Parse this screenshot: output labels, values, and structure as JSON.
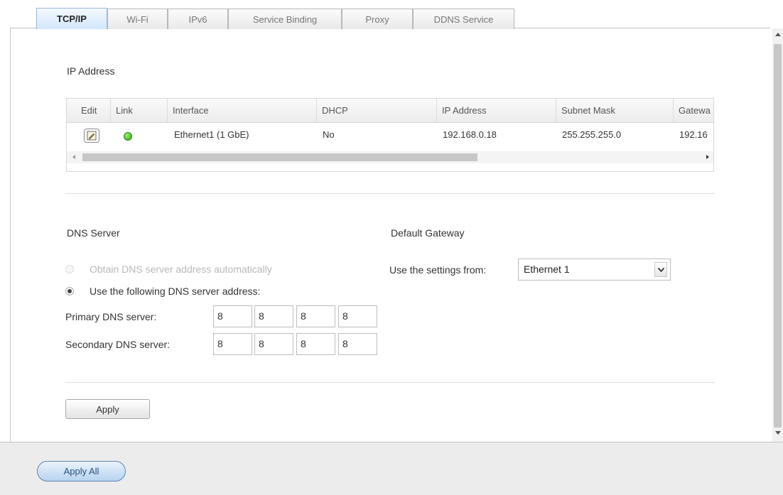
{
  "tabs": [
    {
      "label": "TCP/IP",
      "active": true
    },
    {
      "label": "Wi-Fi",
      "active": false
    },
    {
      "label": "IPv6",
      "active": false
    },
    {
      "label": "Service Binding",
      "active": false
    },
    {
      "label": "Proxy",
      "active": false
    },
    {
      "label": "DDNS Service",
      "active": false
    }
  ],
  "ip_section": {
    "title": "IP Address",
    "columns": [
      "Edit",
      "Link",
      "Interface",
      "DHCP",
      "IP Address",
      "Subnet Mask",
      "Gatewa"
    ],
    "row": {
      "interface": "Ethernet1 (1 GbE)",
      "dhcp": "No",
      "ip_address": "192.168.0.18",
      "subnet_mask": "255.255.255.0",
      "gateway": "192.16",
      "link_status_color": "#3cb21e"
    }
  },
  "dns_section": {
    "title": "DNS Server",
    "auto_option": "Obtain DNS server address automatically",
    "manual_option": "Use the following DNS server address:",
    "primary_label": "Primary DNS server:",
    "secondary_label": "Secondary DNS server:",
    "primary": [
      "8",
      "8",
      "8",
      "8"
    ],
    "secondary": [
      "8",
      "8",
      "8",
      "8"
    ]
  },
  "gateway_section": {
    "title": "Default Gateway",
    "use_settings_label": "Use the settings from:",
    "selected": "Ethernet 1"
  },
  "buttons": {
    "apply": "Apply",
    "apply_all": "Apply All"
  },
  "colors": {
    "active_tab": "#d3e6fb",
    "apply_all_border": "#5c86b5"
  }
}
